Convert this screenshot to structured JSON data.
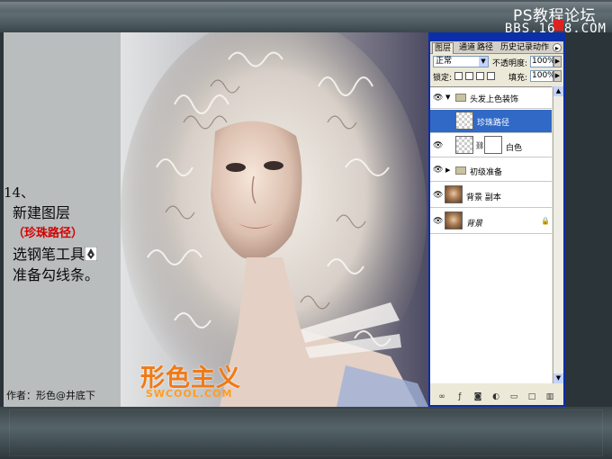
{
  "header": {
    "title": "PS教程论坛",
    "url": "BBS.16  8.COM"
  },
  "left": {
    "step": "14、",
    "lines": [
      "新建图层",
      "（珍珠路径）",
      "选钢笔工具",
      "准备勾线条。"
    ],
    "author": "作者：形色@井底下"
  },
  "watermark": {
    "cn": "形色主义",
    "en": "SWCOOL.COM"
  },
  "panel": {
    "tabs": [
      "图层",
      "通道",
      "路径",
      "历史记录",
      "动作"
    ],
    "blend_mode": "正常",
    "opacity_label": "不透明度:",
    "opacity": "100%",
    "lock_label": "锁定:",
    "fill_label": "填充:",
    "fill": "100%",
    "layers": [
      {
        "name": "头发上色装饰",
        "type": "group",
        "expanded": true
      },
      {
        "name": "珍珠路径",
        "type": "layer",
        "selected": true
      },
      {
        "name": "白色",
        "type": "layer-mask"
      },
      {
        "name": "初级准备",
        "type": "group",
        "expanded": false
      },
      {
        "name": "背景 副本",
        "type": "photo"
      },
      {
        "name": "背景",
        "type": "photo",
        "locked": true
      }
    ]
  },
  "colors": {
    "selection": "#3169c6",
    "panel_border": "#0b2fa8",
    "watermark": "#f07a15",
    "step_red": "#d40000"
  }
}
